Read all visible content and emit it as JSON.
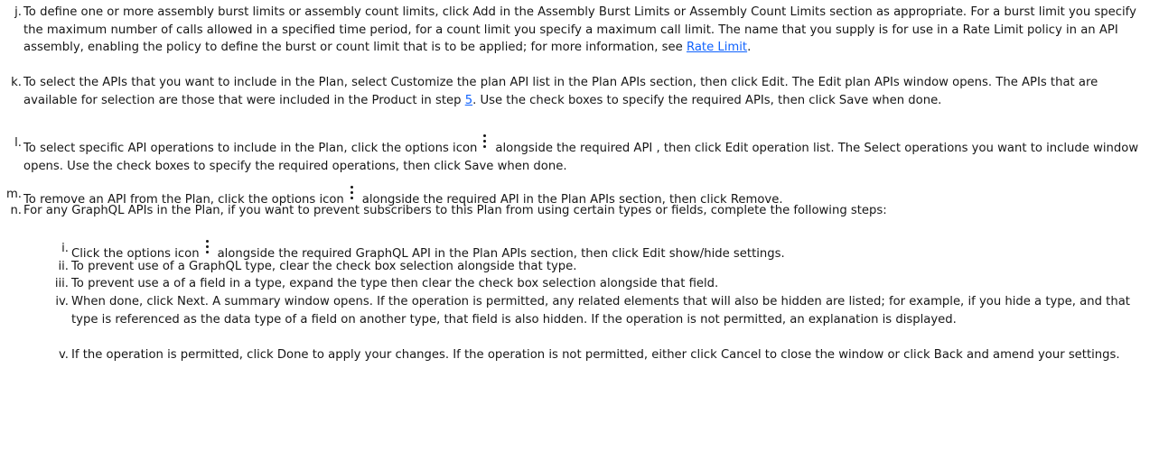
{
  "steps": {
    "j": {
      "marker": "j.",
      "text": "To define one or more assembly burst limits or assembly count limits, click Add in the Assembly Burst Limits or Assembly Count Limits section as appropriate. For a burst limit you specify the maximum number of calls allowed in a specified time period, for a count limit you specify a maximum call limit. The name that you supply is for use in a Rate Limit policy in an API assembly, enabling the policy to define the burst or count limit that is to be applied; for more information, see ",
      "link": "Rate Limit",
      "after": "."
    },
    "k": {
      "marker": "k.",
      "text": "To select the APIs that you want to include in the Plan, select Customize the plan API list in the Plan APIs section, then click Edit. The Edit plan APIs window opens. The APIs that are available for selection are those that were included in the Product in step ",
      "link": "5",
      "after": ". Use the check boxes to specify the required APIs, then click Save when done."
    },
    "l": {
      "marker": "l.",
      "before": "To select specific API operations to include in the Plan, click the options icon",
      "after": "alongside the required API , then click Edit operation list. The Select operations you want to include window opens. Use the check boxes to specify the required operations, then click Save when done."
    },
    "m": {
      "marker": "m.",
      "before": "To remove an API from the Plan, click the options icon",
      "after": "alongside the required API in the Plan APIs section, then click Remove."
    },
    "n": {
      "marker": "n.",
      "text": "For any GraphQL APIs in the Plan, if you want to prevent subscribers to this Plan from using certain types or fields, complete the following steps:"
    }
  },
  "substeps": {
    "i": {
      "marker": "i.",
      "before": "Click the options icon",
      "after": "alongside the required GraphQL API in the Plan APIs section, then click Edit show/hide settings."
    },
    "ii": {
      "marker": "ii.",
      "text": "To prevent use of a GraphQL type, clear the check box selection alongside that type."
    },
    "iii": {
      "marker": "iii.",
      "text": "To prevent use a of a field in a type, expand the type then clear the check box selection alongside that field."
    },
    "iv": {
      "marker": "iv.",
      "text": "When done, click Next. A summary window opens. If the operation is permitted, any related elements that will also be hidden are listed; for example, if you hide a type, and that type is referenced as the data type of a field on another type, that field is also hidden. If the operation is not permitted, an explanation is displayed."
    },
    "v": {
      "marker": "v.",
      "text": "If the operation is permitted, click Done to apply your changes. If the operation is not permitted, either click Cancel to close the window or click Back and amend your settings."
    }
  },
  "icons": {
    "options": "kebab-vertical-icon"
  },
  "colors": {
    "text": "#161616",
    "link": "#0f62fe",
    "background": "#ffffff"
  }
}
